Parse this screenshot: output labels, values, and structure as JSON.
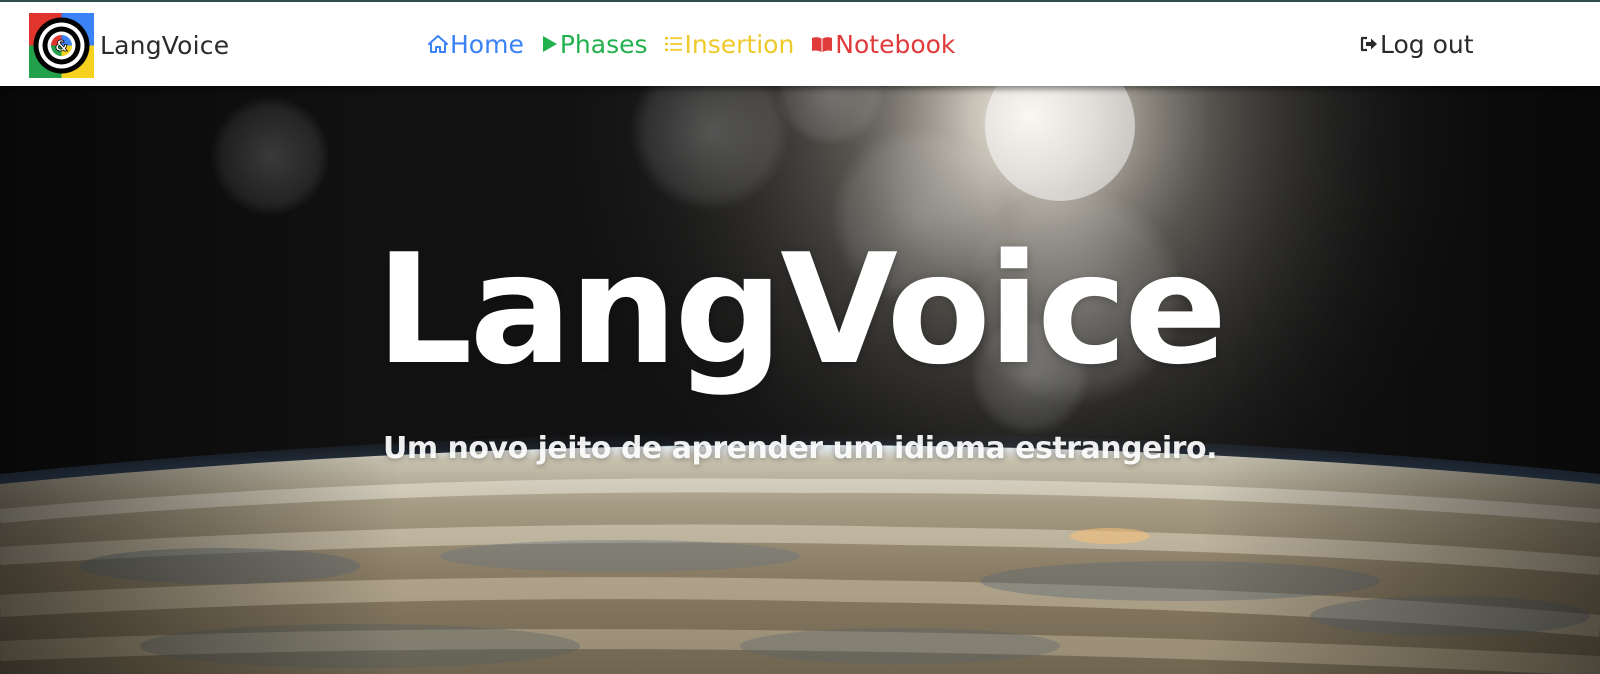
{
  "navbar": {
    "brand": {
      "name": "LangVoice",
      "logo_icon": "langvoice-logo-icon"
    },
    "links": [
      {
        "label": "Home",
        "icon": "home-icon",
        "color": "#3b82f6"
      },
      {
        "label": "Phases",
        "icon": "play-icon",
        "color": "#22b14c"
      },
      {
        "label": "Insertion",
        "icon": "list-icon",
        "color": "#f0c92a"
      },
      {
        "label": "Notebook",
        "icon": "open-book-icon",
        "color": "#e03a3a"
      }
    ],
    "logout": {
      "label": "Log out",
      "icon": "sign-out-icon"
    }
  },
  "hero": {
    "title": "LangVoice",
    "subtitle": "Um novo jeito de aprender um idioma estrangeiro.",
    "background": "earth-from-space-sunrise"
  }
}
